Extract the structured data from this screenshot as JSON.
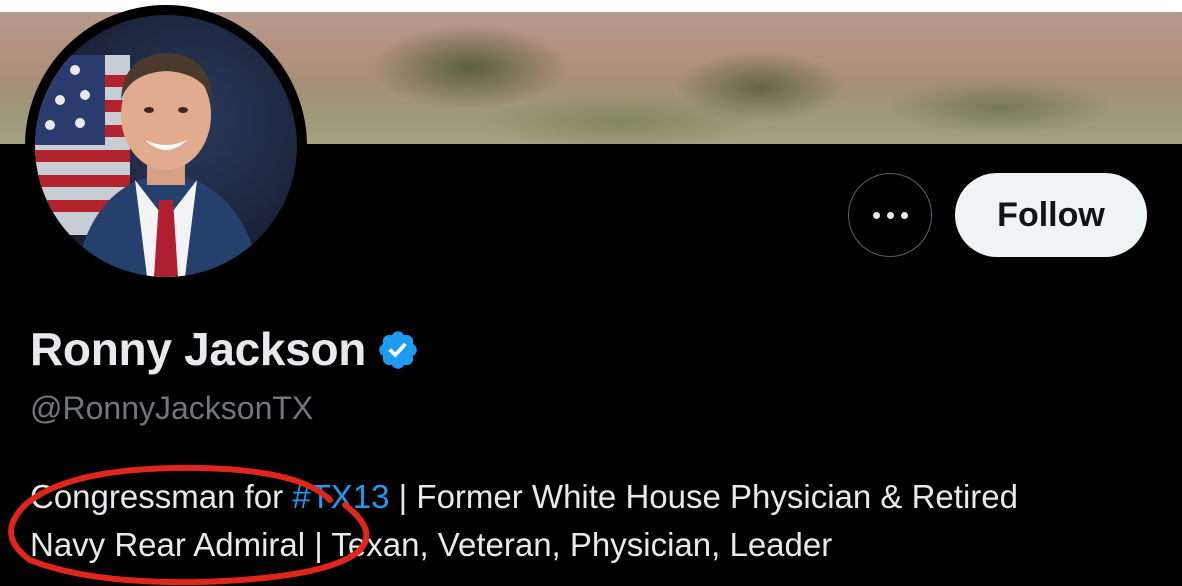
{
  "profile": {
    "display_name": "Ronny Jackson",
    "handle": "@RonnyJacksonTX",
    "bio": {
      "part1": "Congressman for ",
      "hashtag": "#TX13",
      "part2": " | Former White House Physician & Retired",
      "line2": "Navy Rear Admiral | Texan, Veteran, Physician, Leader"
    }
  },
  "actions": {
    "follow_label": "Follow",
    "more_icon": "more-horizontal-icon"
  },
  "icons": {
    "verified": "verified-badge-icon"
  },
  "colors": {
    "background": "#000000",
    "text_primary": "#e7e9ea",
    "text_secondary": "#71767b",
    "link": "#1d9bf0",
    "verified": "#1d9bf0",
    "follow_button_bg": "#eff3f4",
    "annotation": "#e0261b"
  }
}
